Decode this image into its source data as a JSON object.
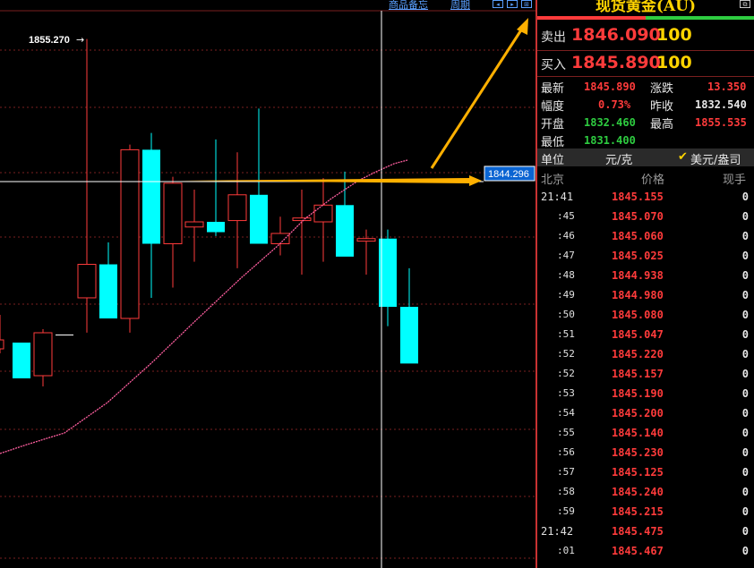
{
  "nav": {
    "product_info": "商品备忘",
    "period": "周期",
    "btn_left": "◂",
    "btn_right": "▸",
    "btn_grid": "⊞"
  },
  "chart": {
    "high_marker": "1855.270",
    "cursor_price": "1844.296",
    "colors": {
      "up": "#ff3b3b",
      "down": "#00ffff",
      "ma": "#ff5fa0",
      "arrow": "#ffb000",
      "grid": "#7a1f1f"
    }
  },
  "chart_data": {
    "type": "candlestick",
    "annotations": [
      "1855.270",
      "1844.296"
    ],
    "candles": [
      {
        "o": 1835.2,
        "h": 1855.3,
        "l": 1832.5,
        "c": 1837.8
      },
      {
        "o": 1837.8,
        "h": 1839.5,
        "l": 1834.0,
        "c": 1833.6
      },
      {
        "o": 1833.6,
        "h": 1847.1,
        "l": 1832.5,
        "c": 1846.7
      },
      {
        "o": 1846.7,
        "h": 1848.0,
        "l": 1835.2,
        "c": 1839.4
      },
      {
        "o": 1839.4,
        "h": 1844.6,
        "l": 1836.0,
        "c": 1844.1
      },
      {
        "o": 1840.7,
        "h": 1843.6,
        "l": 1838.0,
        "c": 1841.1
      },
      {
        "o": 1841.1,
        "h": 1847.5,
        "l": 1840.0,
        "c": 1840.3
      },
      {
        "o": 1841.2,
        "h": 1846.5,
        "l": 1837.5,
        "c": 1843.2
      },
      {
        "o": 1843.2,
        "h": 1849.9,
        "l": 1842.0,
        "c": 1839.4
      },
      {
        "o": 1839.4,
        "h": 1841.5,
        "l": 1838.5,
        "c": 1840.2
      },
      {
        "o": 1841.2,
        "h": 1843.6,
        "l": 1837.0,
        "c": 1841.4
      },
      {
        "o": 1841.1,
        "h": 1844.5,
        "l": 1838.0,
        "c": 1842.4
      },
      {
        "o": 1842.4,
        "h": 1845.0,
        "l": 1839.0,
        "c": 1838.4
      },
      {
        "o": 1839.6,
        "h": 1840.5,
        "l": 1837.0,
        "c": 1839.8
      },
      {
        "o": 1839.8,
        "h": 1840.5,
        "l": 1833.0,
        "c": 1834.5
      },
      {
        "o": 1834.5,
        "h": 1837.5,
        "l": 1831.4,
        "c": 1830.1
      }
    ]
  },
  "panel": {
    "title": "现货黄金(AU)",
    "sell_label": "卖出",
    "sell_price": "1846.090",
    "sell_qty": "100",
    "buy_label": "买入",
    "buy_price": "1845.890",
    "buy_qty": "100",
    "latest_label": "最新",
    "latest": "1845.890",
    "change_label": "涨跌",
    "change": "13.350",
    "range_label": "幅度",
    "range": "0.73%",
    "prevclose_label": "昨收",
    "prevclose": "1832.540",
    "open_label": "开盘",
    "open": "1832.460",
    "high_label": "最高",
    "high": "1855.535",
    "low_label": "最低",
    "low": "1831.400",
    "unit_label": "单位",
    "unit_value": "元/克",
    "currency_option": "美元/盎司",
    "col_time": "北京",
    "col_price": "价格",
    "col_vol": "现手"
  },
  "ticks": [
    {
      "time": "21:41",
      "price": "1845.155",
      "vol": "0",
      "major": true
    },
    {
      "time": ":45",
      "price": "1845.070",
      "vol": "0"
    },
    {
      "time": ":46",
      "price": "1845.060",
      "vol": "0"
    },
    {
      "time": ":47",
      "price": "1845.025",
      "vol": "0"
    },
    {
      "time": ":48",
      "price": "1844.938",
      "vol": "0"
    },
    {
      "time": ":49",
      "price": "1844.980",
      "vol": "0"
    },
    {
      "time": ":50",
      "price": "1845.080",
      "vol": "0"
    },
    {
      "time": ":51",
      "price": "1845.047",
      "vol": "0"
    },
    {
      "time": ":52",
      "price": "1845.220",
      "vol": "0"
    },
    {
      "time": ":52",
      "price": "1845.157",
      "vol": "0"
    },
    {
      "time": ":53",
      "price": "1845.190",
      "vol": "0"
    },
    {
      "time": ":54",
      "price": "1845.200",
      "vol": "0"
    },
    {
      "time": ":55",
      "price": "1845.140",
      "vol": "0"
    },
    {
      "time": ":56",
      "price": "1845.230",
      "vol": "0"
    },
    {
      "time": ":57",
      "price": "1845.125",
      "vol": "0"
    },
    {
      "time": ":58",
      "price": "1845.240",
      "vol": "0"
    },
    {
      "time": ":59",
      "price": "1845.215",
      "vol": "0"
    },
    {
      "time": "21:42",
      "price": "1845.475",
      "vol": "0",
      "major": true
    },
    {
      "time": ":01",
      "price": "1845.467",
      "vol": "0"
    }
  ]
}
